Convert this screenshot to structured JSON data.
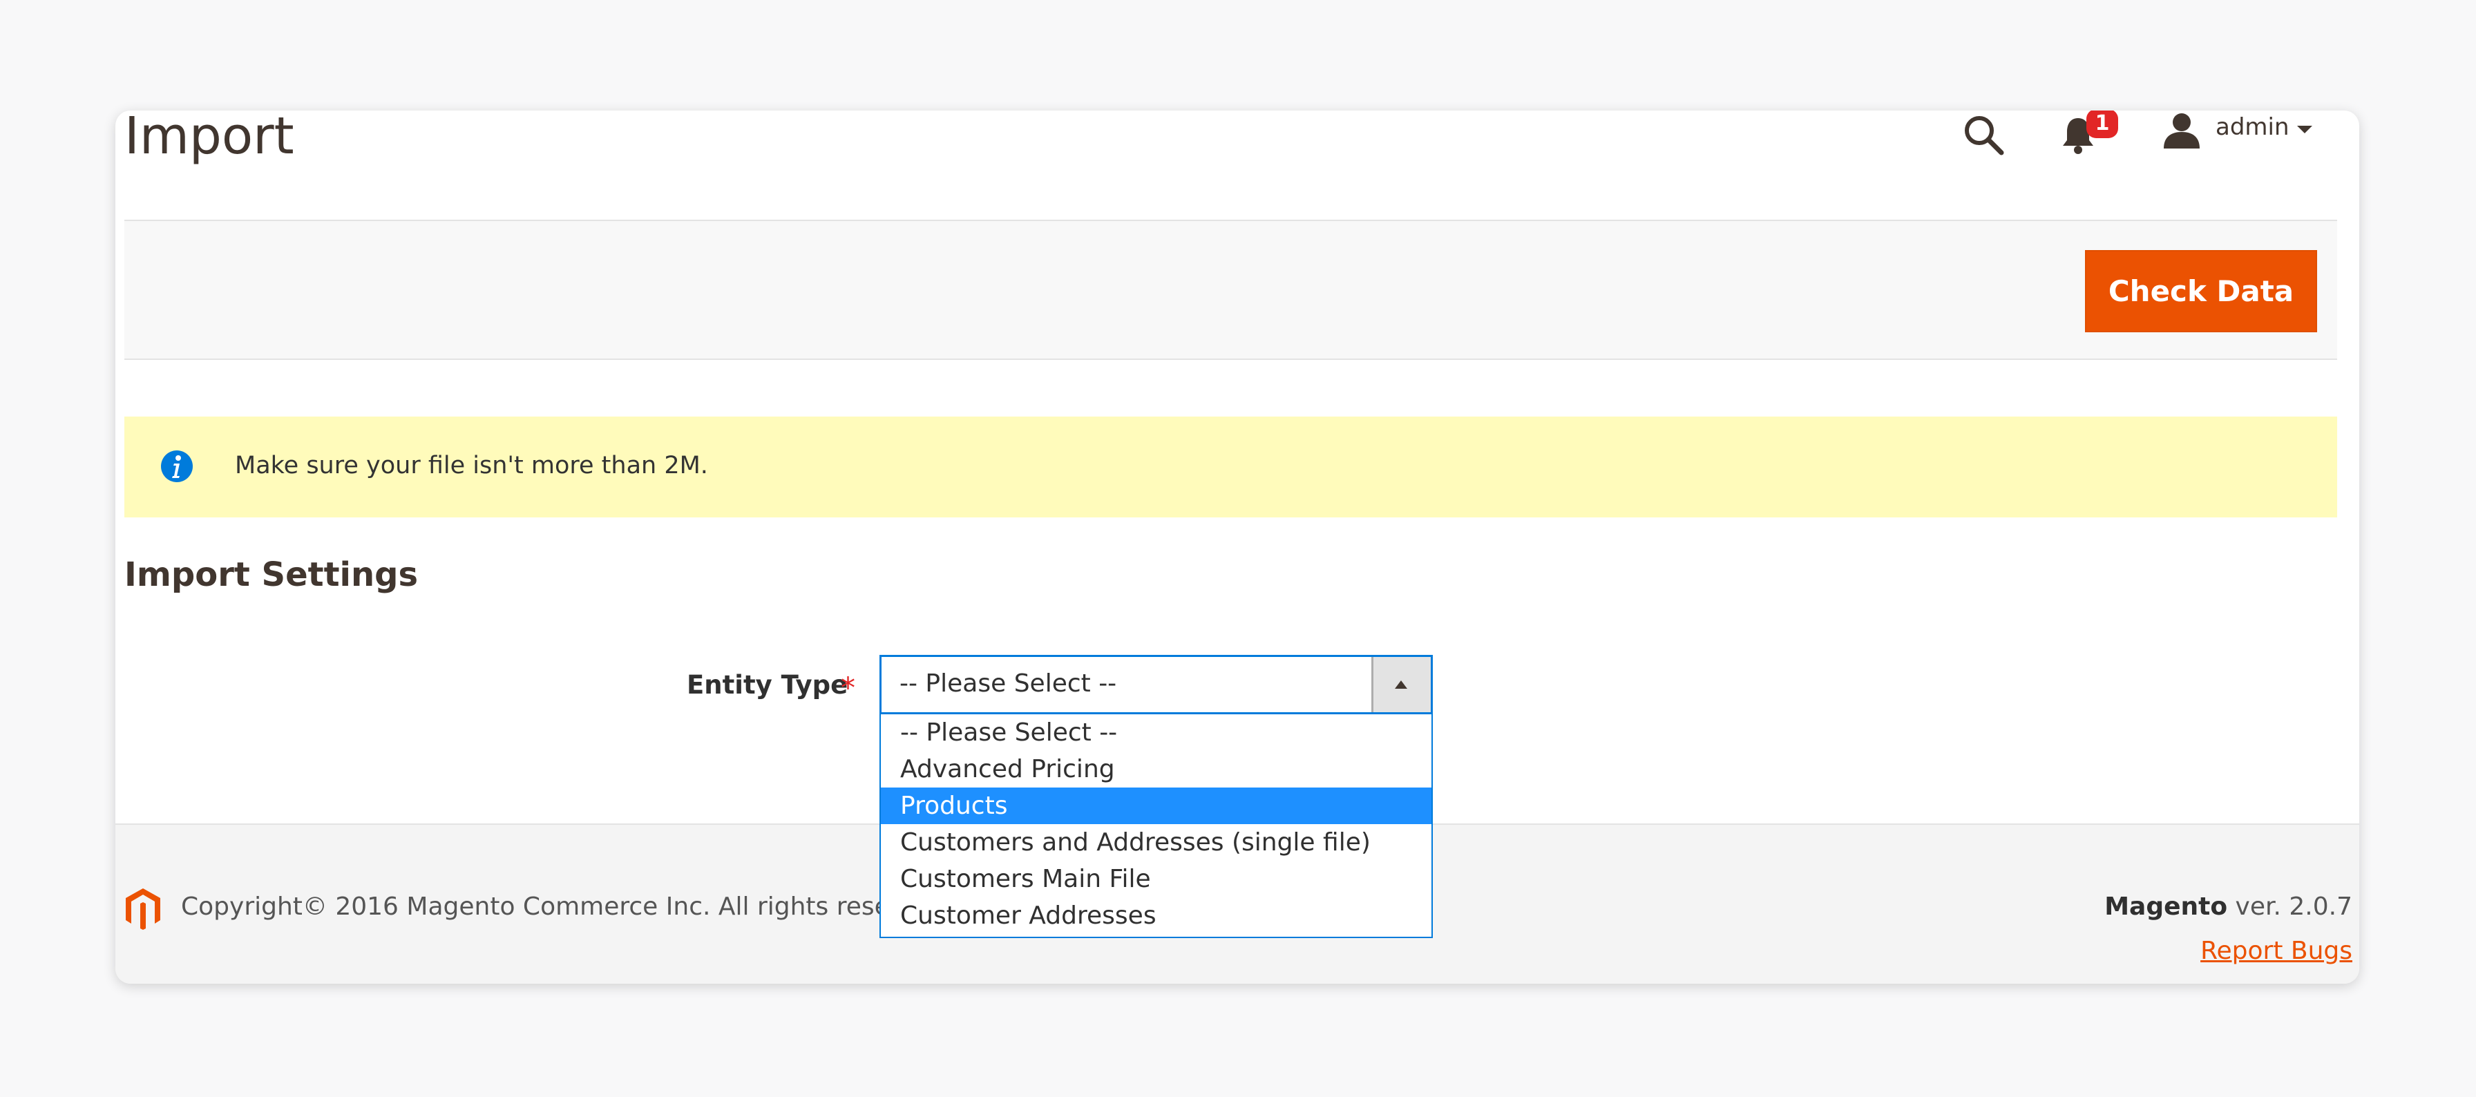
{
  "header": {
    "title": "Import",
    "notification_count": "1",
    "user_name": "admin"
  },
  "actions": {
    "check_data_label": "Check Data"
  },
  "notice": {
    "text": "Make sure your file isn't more than 2M."
  },
  "settings": {
    "section_title": "Import Settings",
    "entity_type_label": "Entity Type",
    "required_mark": "*",
    "entity_type_value": "-- Please Select --",
    "options": [
      {
        "label": "-- Please Select --",
        "highlighted": false
      },
      {
        "label": "Advanced Pricing",
        "highlighted": false
      },
      {
        "label": "Products",
        "highlighted": true
      },
      {
        "label": "Customers and Addresses (single file)",
        "highlighted": false
      },
      {
        "label": "Customers Main File",
        "highlighted": false
      },
      {
        "label": "Customer Addresses",
        "highlighted": false
      }
    ]
  },
  "footer": {
    "copyright": "Copyright© 2016 Magento Commerce Inc. All rights reserved.",
    "brand": "Magento",
    "version": " ver. 2.0.7",
    "report_bugs": "Report Bugs"
  },
  "colors": {
    "accent": "#eb5202",
    "highlight": "#1e90ff",
    "notice_bg": "#fffbbb",
    "badge": "#e22626"
  }
}
